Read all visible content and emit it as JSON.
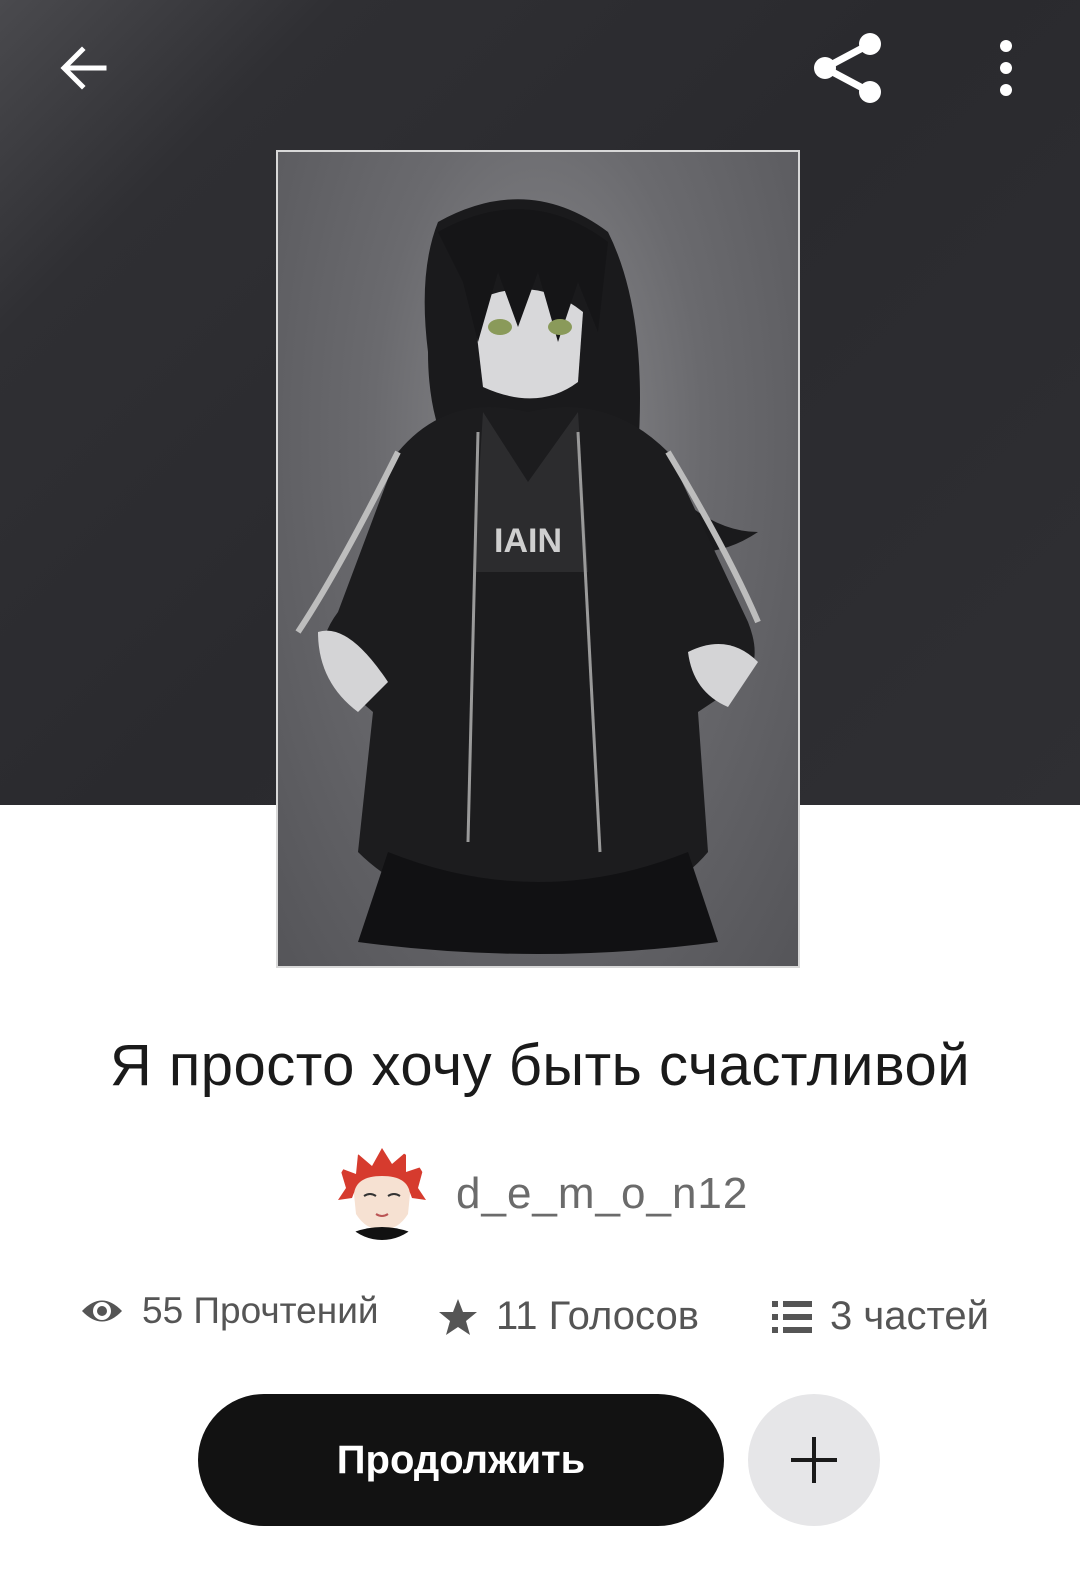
{
  "header": {
    "icons": {
      "back": "arrow-left-icon",
      "share": "share-icon",
      "more": "more-vertical-icon"
    }
  },
  "story": {
    "title": "Я просто хочу быть счастливой",
    "author": "d_e_m_o_n12"
  },
  "stats": {
    "reads": "55 Прочтений",
    "votes": "11 Голосов",
    "parts": "3 частей"
  },
  "actions": {
    "continue_label": "Продолжить",
    "add_icon": "plus-icon"
  },
  "colors": {
    "hero_bg": "#2c2c30",
    "primary_button": "#121212",
    "secondary_button": "#e6e6e8",
    "text_muted": "#555555"
  }
}
